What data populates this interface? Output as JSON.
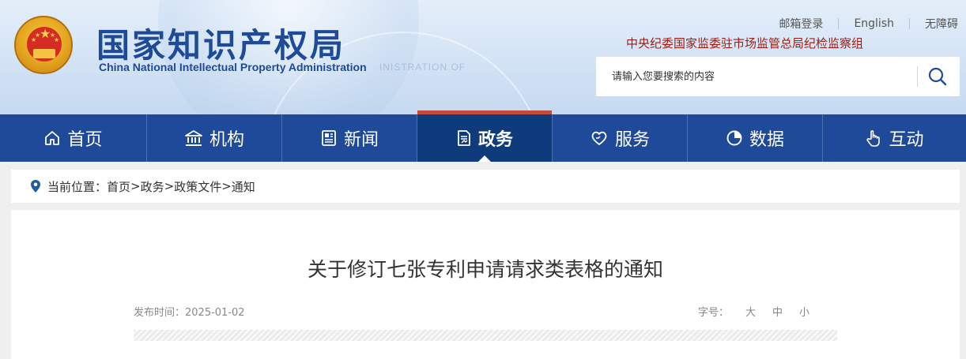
{
  "header": {
    "site_name_cn": "国家知识产权局",
    "site_name_en": "China National Intellectual Property Administration",
    "ghost_text": "INISTRATION OF",
    "links": [
      "邮箱登录",
      "English",
      "无障碍"
    ],
    "dept_link": "中央纪委国家监委驻市场监管总局纪检监察组",
    "search": {
      "placeholder": "请输入您要搜索的内容"
    }
  },
  "nav": {
    "items": [
      {
        "label": "首页",
        "icon": "home-icon"
      },
      {
        "label": "机构",
        "icon": "institution-icon"
      },
      {
        "label": "新闻",
        "icon": "news-icon"
      },
      {
        "label": "政务",
        "icon": "document-icon",
        "active": true
      },
      {
        "label": "服务",
        "icon": "service-heart-icon"
      },
      {
        "label": "数据",
        "icon": "pie-chart-icon"
      },
      {
        "label": "互动",
        "icon": "hand-pointer-icon"
      }
    ]
  },
  "breadcrumb": {
    "prefix": "当前位置：",
    "items": [
      "首页",
      "政务",
      "政策文件",
      "通知"
    ],
    "separator": ">"
  },
  "article": {
    "title": "关于修订七张专利申请请求类表格的通知",
    "publish_label": "发布时间：",
    "publish_date": "2025-01-02",
    "font_size_label": "字号：",
    "font_sizes": [
      "大",
      "中",
      "小"
    ]
  },
  "colors": {
    "nav_bg": "#1f4a9a",
    "nav_active_bg": "#0f3a7c",
    "nav_active_marker": "#c44a3a",
    "brand_blue": "#1d4b97",
    "dept_red": "#9b1c12"
  }
}
